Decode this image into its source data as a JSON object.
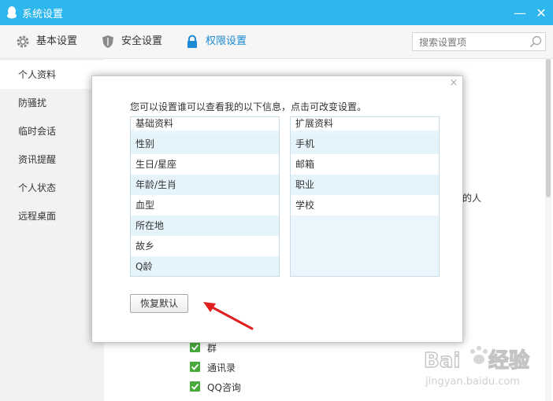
{
  "window": {
    "title": "系统设置",
    "minimize_symbol": "—",
    "close_symbol": "✕"
  },
  "toolbar": {
    "tabs": [
      {
        "label": "基本设置",
        "icon": "gear-icon"
      },
      {
        "label": "安全设置",
        "icon": "shield-icon"
      },
      {
        "label": "权限设置",
        "icon": "lock-icon",
        "active": true
      }
    ],
    "search": {
      "placeholder": "搜索设置项"
    }
  },
  "sidebar": {
    "items": [
      {
        "label": "个人资料",
        "active": true
      },
      {
        "label": "防骚扰"
      },
      {
        "label": "临时会话"
      },
      {
        "label": "资讯提醒"
      },
      {
        "label": "个人状态"
      },
      {
        "label": "远程桌面"
      }
    ]
  },
  "background": {
    "partial_text": "的人",
    "checkboxes": [
      {
        "label": "群",
        "checked": true
      },
      {
        "label": "通讯录",
        "checked": true
      },
      {
        "label": "QQ咨询",
        "checked": true
      }
    ]
  },
  "dialog": {
    "close_symbol": "×",
    "intro": "您可以设置谁可以查看我的以下信息，点击可改变设置。",
    "basic": {
      "header": "基础资料",
      "items": [
        "性别",
        "生日/星座",
        "年龄/生肖",
        "血型",
        "所在地",
        "故乡",
        "Q龄"
      ]
    },
    "extended": {
      "header": "扩展资料",
      "items": [
        "手机",
        "邮箱",
        "职业",
        "学校"
      ]
    },
    "restore_button": "恢复默认"
  },
  "watermark": {
    "text": "Bai du 经验",
    "url_text": "jingyan.baidu.com"
  },
  "colors": {
    "titlebar": "#2eb6ee",
    "accent_tab": "#1d8ad4",
    "checkbox": "#48a93b",
    "list_bg": "#eaf6fc",
    "arrow": "#e02020"
  }
}
